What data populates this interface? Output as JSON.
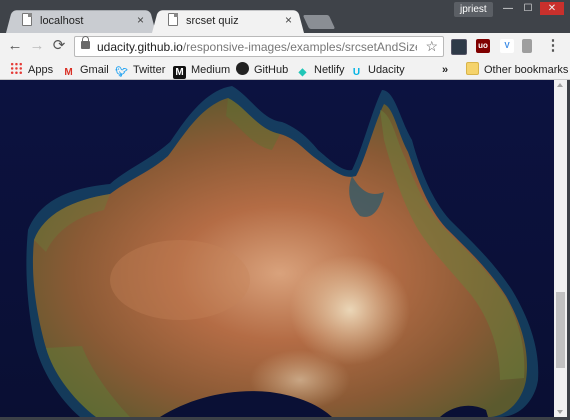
{
  "window": {
    "user_name": "jpriest",
    "controls": {
      "minimize": "—",
      "maximize": "☐",
      "close": "✕"
    }
  },
  "tabs": [
    {
      "title": "localhost",
      "active": false,
      "close": "×"
    },
    {
      "title": "srcset quiz",
      "active": true,
      "close": "×"
    }
  ],
  "toolbar": {
    "back": "←",
    "forward": "→",
    "reload": "⟳",
    "url_host": "udacity.github.io",
    "url_path": "/responsive-images/examples/srcsetAndSizes/index...",
    "star": "☆",
    "extensions": [
      {
        "name": "dark-ext-icon",
        "color": "#2e3a48",
        "glyph": ""
      },
      {
        "name": "ublock-icon",
        "color": "#800000",
        "glyph": "uo"
      },
      {
        "name": "vue-devtools-icon",
        "color": "#ffffff",
        "glyph": "V"
      },
      {
        "name": "gray-ext-icon",
        "color": "#9e9e9e",
        "glyph": ""
      }
    ],
    "menu": "⋮"
  },
  "bookmarks": {
    "items": [
      {
        "label": "Apps",
        "icon": "apps-grid-icon"
      },
      {
        "label": "Gmail",
        "icon": "gmail-icon"
      },
      {
        "label": "Twitter",
        "icon": "twitter-icon"
      },
      {
        "label": "Medium",
        "icon": "medium-icon"
      },
      {
        "label": "GitHub",
        "icon": "github-icon"
      },
      {
        "label": "Netlify",
        "icon": "netlify-icon"
      },
      {
        "label": "Udacity",
        "icon": "udacity-icon"
      }
    ],
    "overflow": "»",
    "other": "Other bookmarks"
  },
  "content": {
    "scroll_position": 0.63
  }
}
